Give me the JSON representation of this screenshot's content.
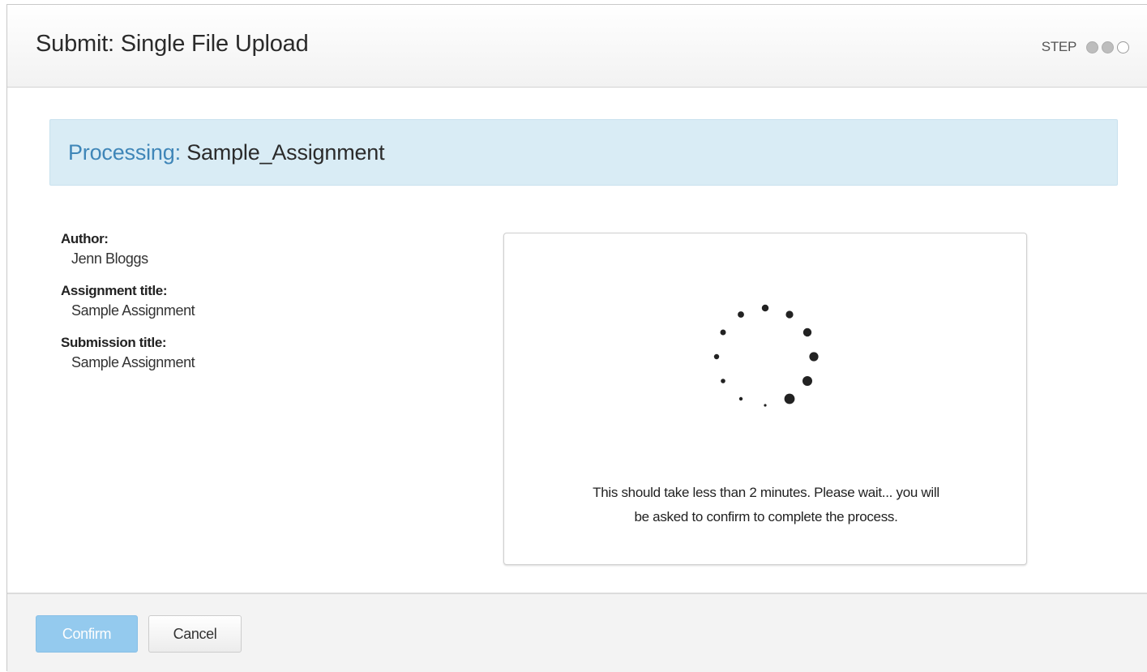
{
  "header": {
    "title": "Submit: Single File Upload",
    "step_label": "STEP",
    "steps": [
      {
        "state": "done"
      },
      {
        "state": "done"
      },
      {
        "state": "todo"
      }
    ]
  },
  "banner": {
    "label": "Processing:",
    "name": "Sample_Assignment",
    "background": "#d9ecf5",
    "label_color": "#3f86b8"
  },
  "details": {
    "author_label": "Author:",
    "author_value": "Jenn Bloggs",
    "assignment_title_label": "Assignment title:",
    "assignment_title_value": "Sample Assignment",
    "submission_title_label": "Submission title:",
    "submission_title_value": "Sample Assignment"
  },
  "panel": {
    "spinner_icon": "loading-spinner-icon",
    "message_line1": "This should take less than 2 minutes. Please wait... you will",
    "message_line2": "be asked to confirm to complete the process."
  },
  "footer": {
    "confirm_label": "Confirm",
    "cancel_label": "Cancel",
    "confirm_color": "#8fc8ee"
  }
}
